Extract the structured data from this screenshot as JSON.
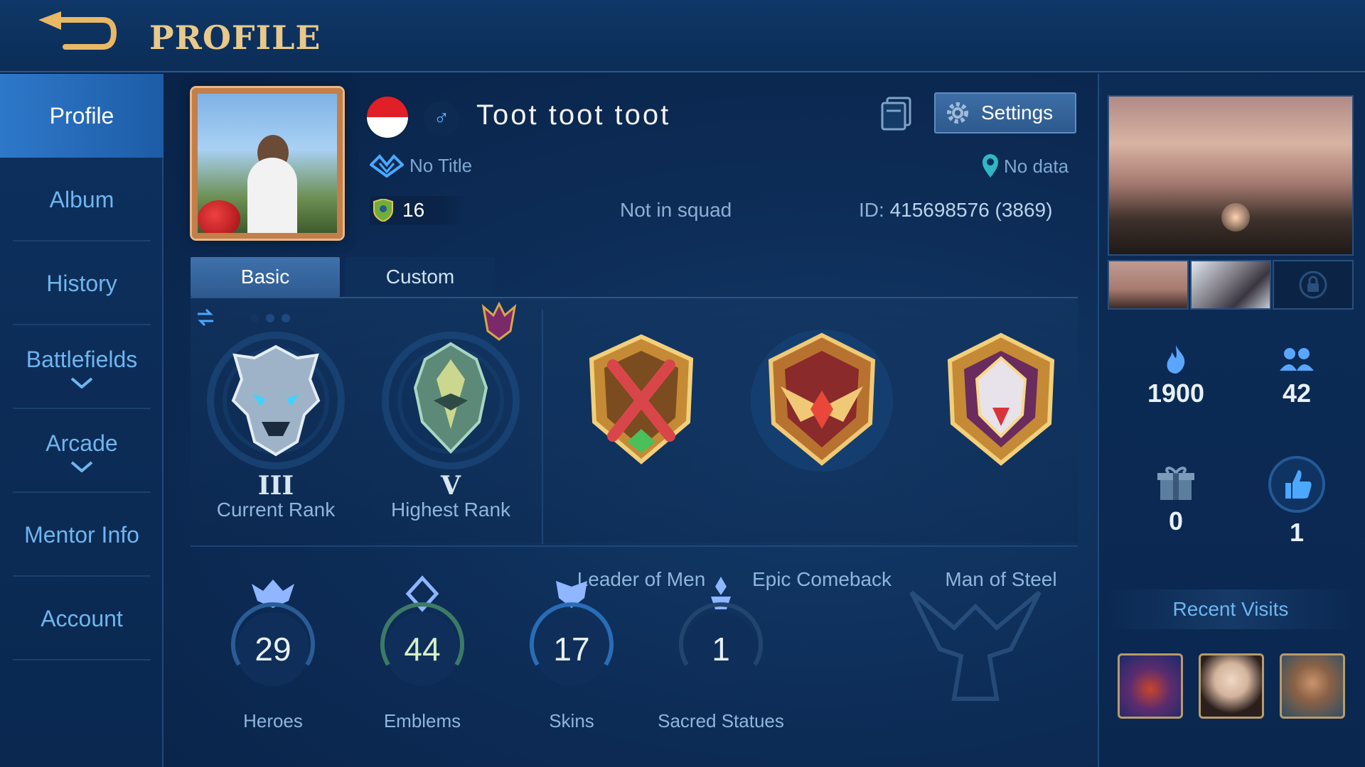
{
  "header": {
    "title": "PROFILE",
    "back_icon": "back-arrow-icon"
  },
  "sidebar": {
    "items": [
      {
        "label": "Profile",
        "active": true
      },
      {
        "label": "Album"
      },
      {
        "label": "History"
      },
      {
        "label": "Battlefields",
        "expandable": true
      },
      {
        "label": "Arcade",
        "expandable": true
      },
      {
        "label": "Mentor Info"
      },
      {
        "label": "Account"
      }
    ]
  },
  "player": {
    "name": "Toot toot toot",
    "gender_symbol": "♂",
    "flag": "indonesia",
    "title": "No Title",
    "location": "No data",
    "level": "16",
    "squad": "Not in squad",
    "id_label": "ID:",
    "id_value": "415698576 (3869)"
  },
  "actions": {
    "settings_label": "Settings"
  },
  "tabs": [
    {
      "label": "Basic",
      "active": true
    },
    {
      "label": "Custom"
    }
  ],
  "ranks": [
    {
      "roman": "III",
      "label": "Current Rank"
    },
    {
      "roman": "V",
      "label": "Highest Rank"
    }
  ],
  "medals": [
    {
      "label": "Leader of Men"
    },
    {
      "label": "Epic Comeback"
    },
    {
      "label": "Man of Steel"
    }
  ],
  "stats": [
    {
      "value": "29",
      "label": "Heroes"
    },
    {
      "value": "44",
      "label": "Emblems"
    },
    {
      "value": "17",
      "label": "Skins"
    },
    {
      "value": "1",
      "label": "Sacred Statues"
    }
  ],
  "right": {
    "popularity": "1900",
    "friends": "42",
    "gifts": "0",
    "likes": "1",
    "recent_title": "Recent Visits"
  },
  "colors": {
    "accent": "#e9c98a",
    "sidebar_active": "#2e78c9",
    "text_blue": "#6fb5ee",
    "gold": "#d9a648"
  }
}
